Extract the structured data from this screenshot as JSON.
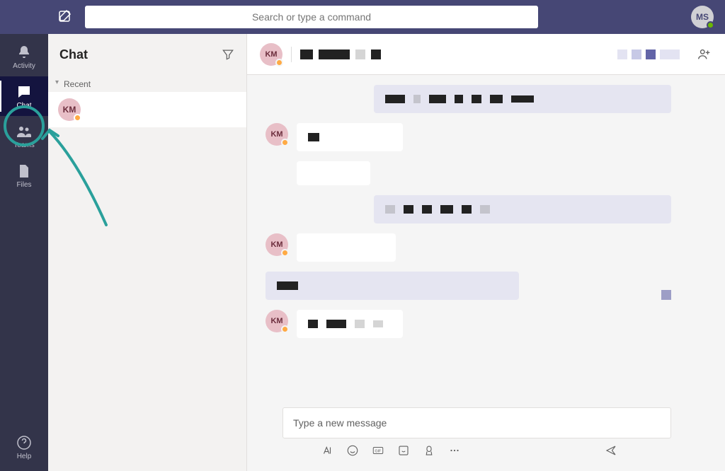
{
  "search": {
    "placeholder": "Search or type a command"
  },
  "self_avatar": {
    "initials": "MS",
    "status": "available"
  },
  "rail": {
    "activity": "Activity",
    "chat": "Chat",
    "teams": "Teams",
    "files": "Files",
    "help": "Help",
    "active": "chat"
  },
  "chat_panel": {
    "title": "Chat",
    "section": "Recent",
    "items": [
      {
        "initials": "KM",
        "status": "away"
      }
    ]
  },
  "conversation": {
    "header": {
      "initials": "KM",
      "status": "away"
    },
    "messages": [
      {
        "from": "self",
        "bubble": "out"
      },
      {
        "from": "other",
        "initials": "KM",
        "bubble": "in"
      },
      {
        "from": "other",
        "continued": true,
        "bubble": "in"
      },
      {
        "from": "self",
        "bubble": "out"
      },
      {
        "from": "other",
        "initials": "KM",
        "bubble": "in"
      },
      {
        "from": "self",
        "bubble": "out",
        "reacted": true
      },
      {
        "from": "other",
        "initials": "KM",
        "bubble": "in"
      }
    ]
  },
  "composer": {
    "placeholder": "Type a new message"
  }
}
